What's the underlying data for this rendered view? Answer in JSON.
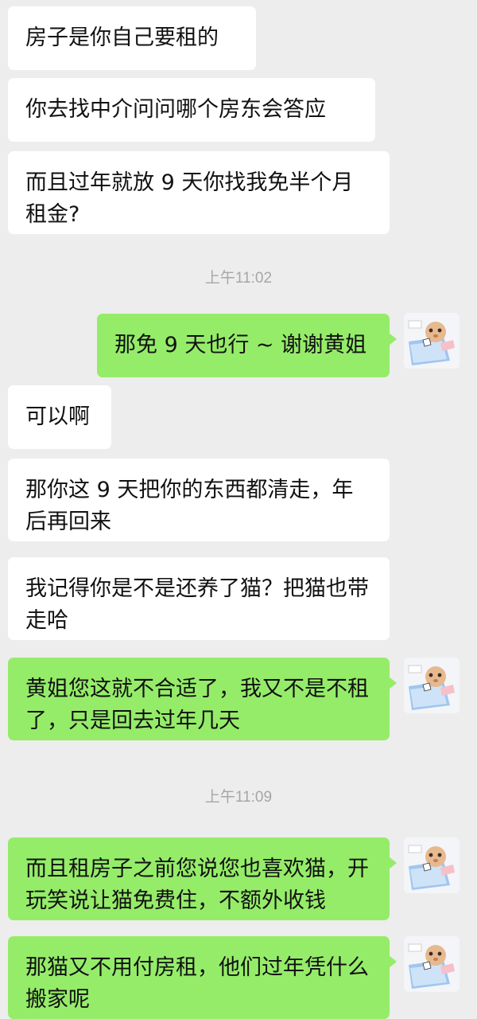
{
  "messages": [
    {
      "text": "房子是你自己要租的"
    },
    {
      "text": "你去找中介问问哪个房东会答应"
    },
    {
      "text": "而且过年就放 9 天你找我免半个月租金?"
    },
    {
      "text": "那免 9 天也行 ~ 谢谢黄姐"
    },
    {
      "text": "可以啊"
    },
    {
      "text": "那你这 9 天把你的东西都清走，年后再回来"
    },
    {
      "text": "我记得你是不是还养了猫？把猫也带走哈"
    },
    {
      "text": "黄姐您这就不合适了，我又不是不租了，只是回去过年几天"
    },
    {
      "text": "而且租房子之前您说您也喜欢猫，开玩笑说让猫免费住，不额外收钱"
    },
    {
      "text": "那猫又不用付房租，他们过年凭什么搬家呢"
    }
  ],
  "timestamps": [
    "上午11:02",
    "上午11:09"
  ],
  "avatar_icon": "cartoon-character-avatar",
  "colors": {
    "background": "#ededed",
    "incoming_bubble": "#ffffff",
    "outgoing_bubble": "#95ec69",
    "timestamp": "#a6a6a6"
  }
}
